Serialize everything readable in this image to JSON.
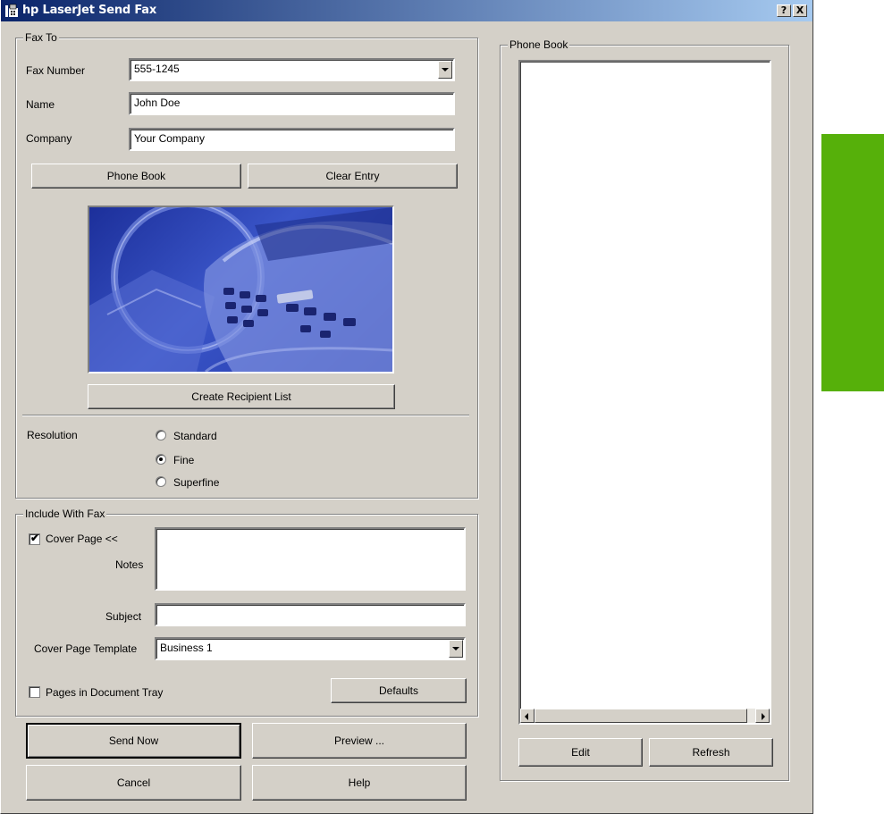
{
  "window": {
    "title": "hp LaserJet Send Fax",
    "help_button": "?",
    "close_button": "X"
  },
  "fax_to": {
    "legend": "Fax To",
    "fax_number_label": "Fax Number",
    "fax_number_value": "555-1245",
    "name_label": "Name",
    "name_value": "John Doe",
    "company_label": "Company",
    "company_value": "Your Company",
    "phone_book_button": "Phone Book",
    "clear_entry_button": "Clear Entry",
    "create_recipient_list_button": "Create Recipient List",
    "resolution_label": "Resolution",
    "resolution_options": [
      {
        "label": "Standard",
        "selected": false
      },
      {
        "label": "Fine",
        "selected": true
      },
      {
        "label": "Superfine",
        "selected": false
      }
    ]
  },
  "include_with_fax": {
    "legend": "Include With Fax",
    "cover_page_label": "Cover Page <<",
    "cover_page_checked": true,
    "notes_label": "Notes",
    "notes_value": "",
    "subject_label": "Subject",
    "subject_value": "",
    "template_label": "Cover Page Template",
    "template_value": "Business 1",
    "pages_in_tray_label": "Pages in Document Tray",
    "pages_in_tray_checked": false,
    "defaults_button": "Defaults"
  },
  "actions": {
    "send_now": "Send Now",
    "preview": "Preview ...",
    "cancel": "Cancel",
    "help": "Help"
  },
  "phone_book": {
    "legend": "Phone Book",
    "edit_button": "Edit",
    "refresh_button": "Refresh"
  },
  "colors": {
    "dialog_bg": "#d4d0c8",
    "titlebar_start": "#0a246a",
    "titlebar_end": "#a6caf0",
    "side_tab": "#56b00a",
    "image_blue": "#2a44b8"
  },
  "icons": [
    "fax-app-icon",
    "dropdown-arrow-icon",
    "scroll-left-arrow-icon",
    "scroll-right-arrow-icon",
    "checkmark-icon"
  ]
}
